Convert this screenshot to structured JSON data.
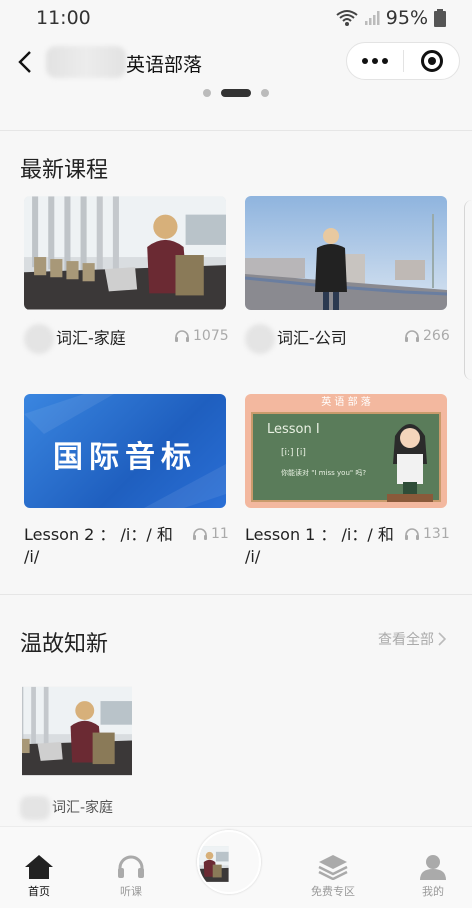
{
  "status_bar": {
    "time": "11:00",
    "battery": "95%"
  },
  "nav": {
    "title": "英语部落"
  },
  "latest": {
    "title": "最新课程",
    "courses": [
      {
        "title": "词汇-家庭",
        "plays": "1075"
      },
      {
        "title": "词汇-公司",
        "plays": "266"
      },
      {
        "title": "Lesson 2 ： /i：/ 和 /i/",
        "plays": "11",
        "cover_text": "国际音标"
      },
      {
        "title": "Lesson 1 ： /i：/ 和 /i/",
        "plays": "131",
        "cover_banner": "英 语 部 落",
        "cover_heading": "Lesson I",
        "cover_phonetics": "[i:]  [i]",
        "cover_question": "你能读对 \"I miss you\" 吗?"
      }
    ]
  },
  "review": {
    "title": "温故知新",
    "see_all": "查看全部",
    "items": [
      {
        "title": "词汇-家庭"
      }
    ]
  },
  "tabbar": {
    "items": [
      {
        "label": "首页",
        "icon": "home-icon",
        "active": true
      },
      {
        "label": "听课",
        "icon": "headphones-icon",
        "active": false
      },
      {
        "label": "免费专区",
        "icon": "layers-icon",
        "active": false
      },
      {
        "label": "我的",
        "icon": "profile-icon",
        "active": false
      }
    ]
  },
  "colors": {
    "accent": "#111111",
    "muted": "#9a9a9a",
    "blue_cover": "#2f74d0",
    "chalkboard": "#5a7c5a",
    "banner": "#f3b89f"
  }
}
